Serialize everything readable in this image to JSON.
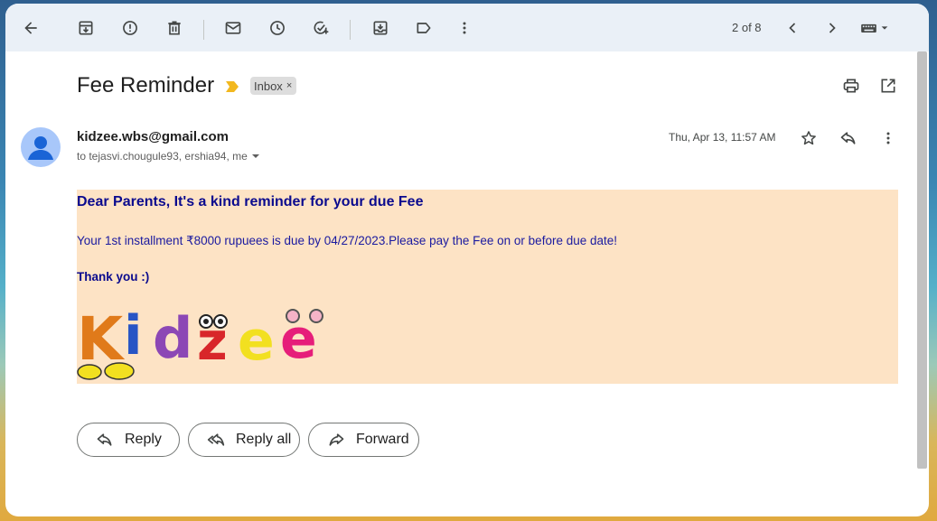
{
  "toolbar": {
    "pager": "2 of 8",
    "icons": [
      "back-arrow-icon",
      "archive-icon",
      "report-spam-icon",
      "delete-icon",
      "mark-unread-icon",
      "snooze-icon",
      "add-task-icon",
      "move-to-icon",
      "label-icon",
      "more-vert-icon",
      "newer-icon",
      "older-icon",
      "input-tools-icon"
    ]
  },
  "message": {
    "subject": "Fee Reminder",
    "label": "Inbox",
    "label_remove": "×",
    "sender": "kidzee.wbs@gmail.com",
    "recipients": "to tejasvi.chougule93, ershia94, me",
    "date": "Thu, Apr 13, 11:57 AM"
  },
  "body": {
    "greeting": "Dear Parents, It's a kind reminder for your due Fee",
    "installment": "Your 1st installment ₹8000 rupuees is due by 04/27/2023.Please pay the Fee on or before due date!",
    "thanks": "Thank you :)",
    "logo_text": "Kidzee"
  },
  "actions": {
    "reply": "Reply",
    "reply_all": "Reply all",
    "forward": "Forward"
  },
  "colors": {
    "body_bg": "#fde3c5",
    "text_blue": "#0a0a8e",
    "importance": "#f2b81f"
  }
}
